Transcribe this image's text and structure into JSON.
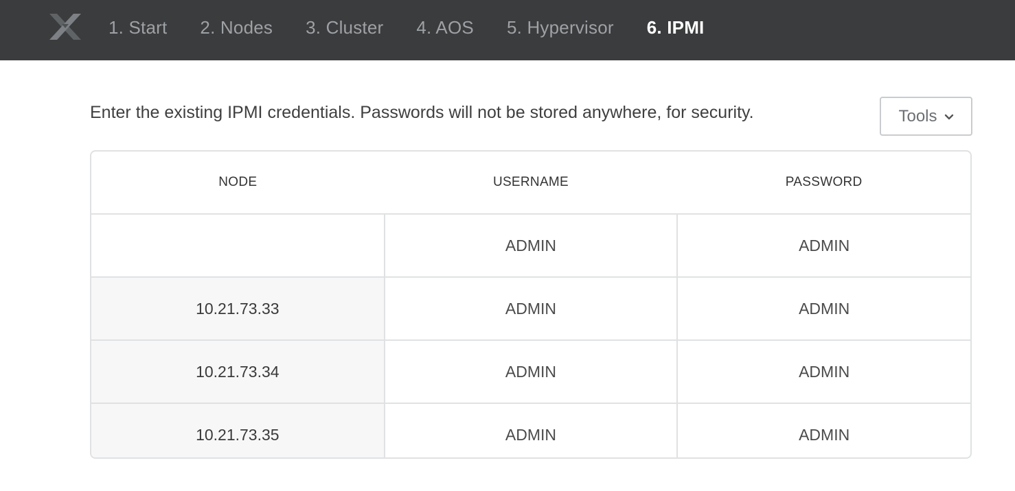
{
  "nav": {
    "logo_icon": "nutanix-x-logo",
    "steps": [
      {
        "label": "1. Start"
      },
      {
        "label": "2. Nodes"
      },
      {
        "label": "3. Cluster"
      },
      {
        "label": "4. AOS"
      },
      {
        "label": "5. Hypervisor"
      },
      {
        "label": "6. IPMI"
      }
    ],
    "active_step": "6. IPMI"
  },
  "main": {
    "intro": "Enter the existing IPMI credentials. Passwords will not be stored anywhere, for security.",
    "tools_label": "Tools",
    "tools_icon": "chevron-down-icon"
  },
  "table": {
    "headers": {
      "node": "NODE",
      "username": "USERNAME",
      "password": "PASSWORD"
    },
    "rows": [
      {
        "node": "",
        "username": "ADMIN",
        "password": "ADMIN"
      },
      {
        "node": "10.21.73.33",
        "username": "ADMIN",
        "password": "ADMIN"
      },
      {
        "node": "10.21.73.34",
        "username": "ADMIN",
        "password": "ADMIN"
      },
      {
        "node": "10.21.73.35",
        "username": "ADMIN",
        "password": "ADMIN"
      }
    ]
  },
  "colors": {
    "topbar": "#3b3c3d",
    "active_step": "#ffffff",
    "inactive_step": "#9ea1a5",
    "border": "#e0e1e2"
  }
}
